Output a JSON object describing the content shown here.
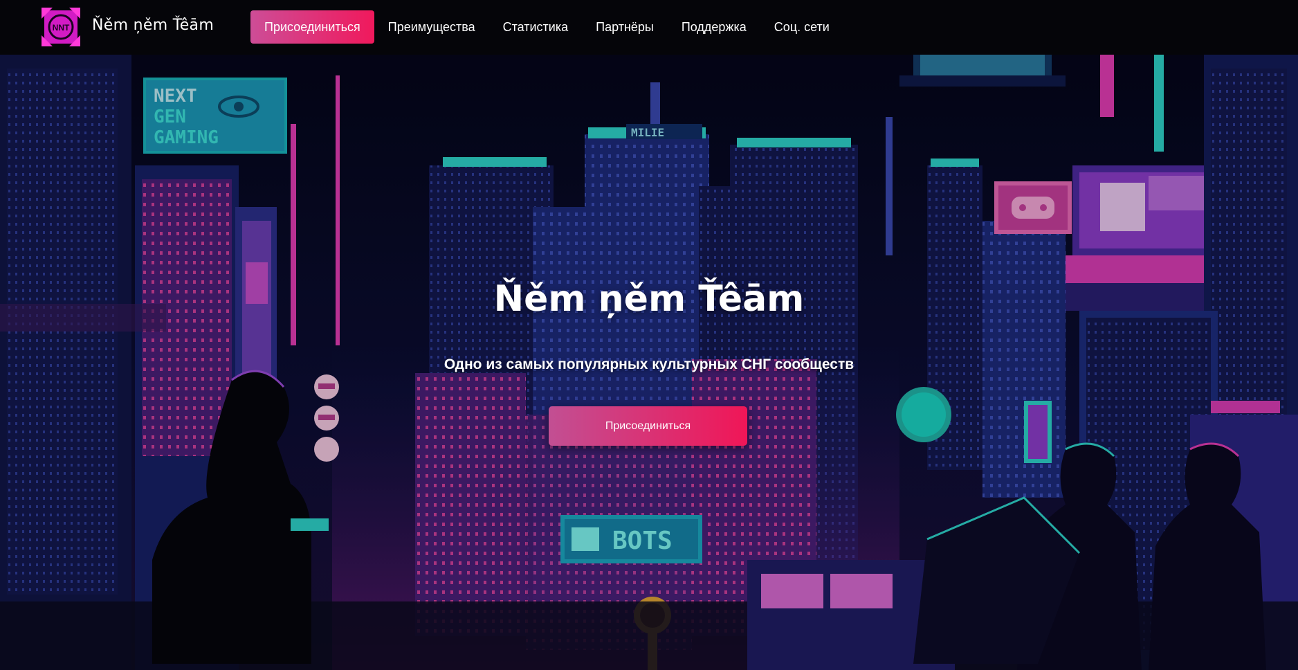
{
  "brand": {
    "name": "Ňěm ņěm Ťêām",
    "logo_text": "NNT"
  },
  "nav": {
    "items": [
      {
        "label": "Присоединиться",
        "active": true
      },
      {
        "label": "Преимущества"
      },
      {
        "label": "Статистика"
      },
      {
        "label": "Партнёры"
      },
      {
        "label": "Поддержка"
      },
      {
        "label": "Соц. сети"
      }
    ]
  },
  "hero": {
    "title": "Ňěm ņěm Ťêām",
    "subtitle": "Одно из самых популярных культурных СНГ сообществ",
    "cta_label": "Присоединиться",
    "signs": {
      "next": "NEXT",
      "gen": "GEN",
      "gaming": "GAMING",
      "bots": "BOTS",
      "bldg": "MILIE"
    }
  },
  "colors": {
    "accent_start": "#c24f93",
    "accent_end": "#f01657",
    "neon_pink": "#e23cb4",
    "neon_cyan": "#30d6d6",
    "sky": "#090a26"
  }
}
